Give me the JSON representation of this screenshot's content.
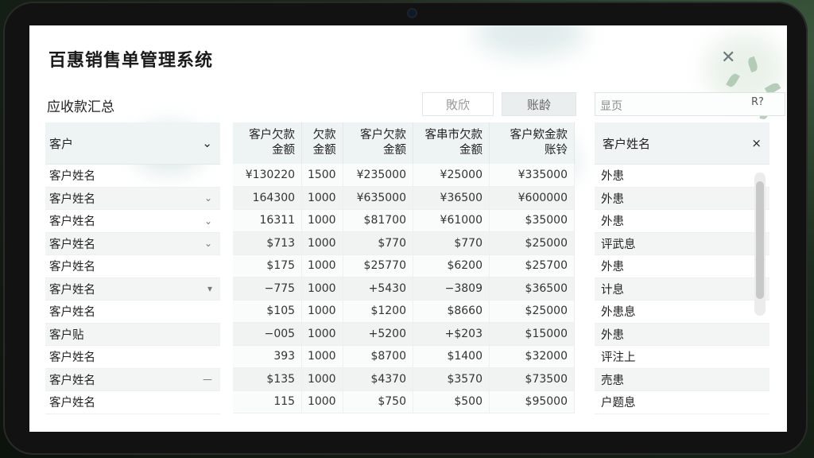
{
  "app": {
    "title": "百惠销售单管理系统",
    "close_glyph": "✕"
  },
  "section": {
    "title": "应收款汇总"
  },
  "toolbar": {
    "disabled_button": "敗欣",
    "ledger_button": "账龄"
  },
  "search": {
    "placeholder": "显页",
    "icon_label": "R?"
  },
  "left_column": {
    "header": "客户",
    "rows": [
      {
        "label": "客户姓名",
        "indicator": ""
      },
      {
        "label": "客户姓名",
        "indicator": "⌄"
      },
      {
        "label": "客户姓名",
        "indicator": "⌄"
      },
      {
        "label": "客户姓名",
        "indicator": "⌄"
      },
      {
        "label": "客户姓名",
        "indicator": ""
      },
      {
        "label": "客户姓名",
        "indicator": "▾"
      },
      {
        "label": "客户姓名",
        "indicator": ""
      },
      {
        "label": "客户贴",
        "indicator": ""
      },
      {
        "label": "客户姓名",
        "indicator": ""
      },
      {
        "label": "客户姓名",
        "indicator": "—"
      },
      {
        "label": "客户姓名",
        "indicator": ""
      }
    ]
  },
  "table": {
    "columns": [
      [
        "客户欠款",
        "金额"
      ],
      [
        "欠款",
        "金额"
      ],
      [
        "客户欠款",
        "金额"
      ],
      [
        "客串市欠款",
        "金额"
      ],
      [
        "客户欸金款",
        "账铃"
      ]
    ],
    "rows": [
      [
        "¥130220",
        "1500",
        "¥235000",
        "¥25000",
        "¥335000"
      ],
      [
        "164300",
        "1000",
        "¥635000",
        "¥36500",
        "¥600000"
      ],
      [
        "16311",
        "1000",
        "$81700",
        "¥61000",
        "$35000"
      ],
      [
        "$713",
        "1000",
        "$770",
        "$770",
        "$25000"
      ],
      [
        "$175",
        "1000",
        "$25770",
        "$6200",
        "$25700"
      ],
      [
        "−775",
        "1000",
        "+5430",
        "−3809",
        "$36500"
      ],
      [
        "$105",
        "1000",
        "$1200",
        "$8660",
        "$25000"
      ],
      [
        "−005",
        "1000",
        "+5200",
        "+$203",
        "$15000"
      ],
      [
        "393",
        "1000",
        "$8700",
        "$1400",
        "$32000"
      ],
      [
        "$135",
        "1000",
        "$4370",
        "$3570",
        "$73500"
      ],
      [
        "115",
        "1000",
        "$750",
        "$500",
        "$95000"
      ]
    ]
  },
  "right_column": {
    "header": "客户姓名",
    "close_glyph": "×",
    "rows": [
      "外患",
      "外患",
      "外患",
      "评武息",
      "外患",
      "计息",
      "外患息",
      "外患",
      "评注上",
      "売患",
      "户题息"
    ]
  }
}
